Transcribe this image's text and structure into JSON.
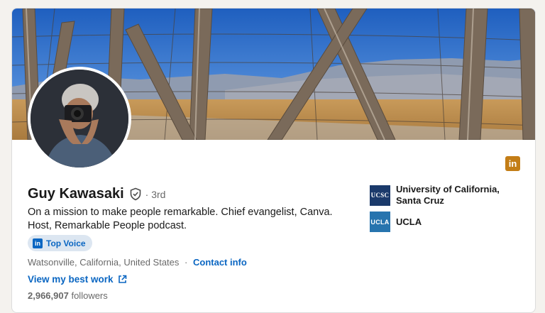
{
  "profile": {
    "name": "Guy Kawasaki",
    "degree": "3rd",
    "headline": "On a mission to make people remarkable. Chief evangelist, Canva. Host, Remarkable People podcast.",
    "badge_label": "Top Voice",
    "location": "Watsonville, California, United States",
    "separator": "·",
    "contact_label": "Contact info",
    "best_work_label": "View my best work",
    "followers_count": "2,966,907",
    "followers_label": "followers"
  },
  "icons": {
    "linkedin_short": "in",
    "verified": "shield-check-icon",
    "external": "external-link-icon"
  },
  "education": [
    {
      "logo_text": "UCSC",
      "name": "University of California, Santa Cruz"
    },
    {
      "logo_text": "UCLA",
      "name": "UCLA"
    }
  ],
  "colors": {
    "link": "#0a66c2",
    "badge_bg": "#dce6f1",
    "linkedin_orange": "#c37d16",
    "ucsc_navy": "#1b3a6b",
    "ucla_blue": "#2774ae"
  }
}
